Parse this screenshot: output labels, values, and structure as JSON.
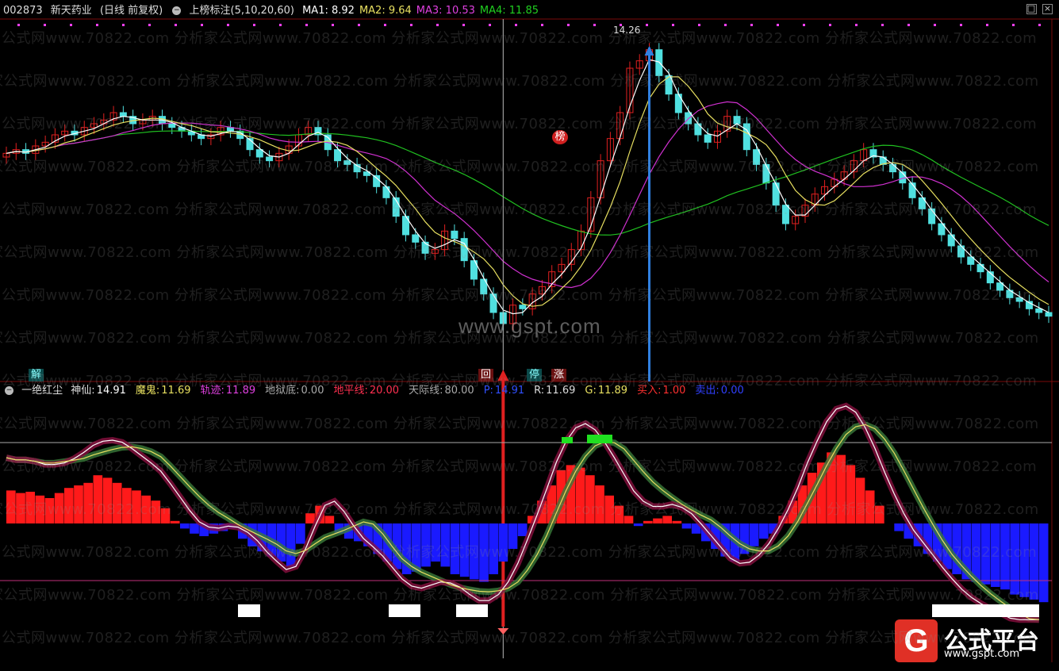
{
  "header_top": {
    "code": "002873",
    "name": "新天药业",
    "mode": "(日线 前复权)",
    "indicator": "上榜标注(5,10,20,60)",
    "ma": [
      {
        "label": "MA1:",
        "value": "8.92",
        "color": "#ffffff"
      },
      {
        "label": "MA2:",
        "value": "9.64",
        "color": "#e8e060"
      },
      {
        "label": "MA3:",
        "value": "10.53",
        "color": "#e040e0"
      },
      {
        "label": "MA4:",
        "value": "11.85",
        "color": "#20d020"
      }
    ]
  },
  "header_bottom": {
    "name": "一绝红尘",
    "items": [
      {
        "label": "神仙:",
        "value": "14.91",
        "lcolor": "#dddddd",
        "vcolor": "#ffffff"
      },
      {
        "label": "魔鬼:",
        "value": "11.69",
        "lcolor": "#e8e060",
        "vcolor": "#e8e060"
      },
      {
        "label": "轨迹:",
        "value": "11.89",
        "lcolor": "#e040e0",
        "vcolor": "#e040e0"
      },
      {
        "label": "地狱底:",
        "value": "0.00",
        "lcolor": "#aaaaaa",
        "vcolor": "#aaaaaa"
      },
      {
        "label": "地平线:",
        "value": "20.00",
        "lcolor": "#ff3050",
        "vcolor": "#ff3050"
      },
      {
        "label": "天际线:",
        "value": "80.00",
        "lcolor": "#aaaaaa",
        "vcolor": "#aaaaaa"
      },
      {
        "label": "P:",
        "value": "14.91",
        "lcolor": "#3050ff",
        "vcolor": "#3050ff"
      },
      {
        "label": "R:",
        "value": "11.69",
        "lcolor": "#dddddd",
        "vcolor": "#dddddd"
      },
      {
        "label": "G:",
        "value": "11.89",
        "lcolor": "#e8e060",
        "vcolor": "#e8e060"
      },
      {
        "label": "买入:",
        "value": "1.00",
        "lcolor": "#ff3030",
        "vcolor": "#ff3030"
      },
      {
        "label": "卖出:",
        "value": "0.00",
        "lcolor": "#3040ff",
        "vcolor": "#3040ff"
      }
    ]
  },
  "tags": {
    "jie": "解",
    "hui": "回",
    "ting": "停",
    "zhang": "涨",
    "bang": "榜"
  },
  "annotations": {
    "high_label": "14.26"
  },
  "watermark": {
    "text": "公式网www.70822.com 分析家公式网www.70822.com 分析家公式网www.70822.com 分析家公式网www.70822.com 分析家公式网www.70822.com",
    "text2": "家公式网www.70822.com 分析家公式网www.70822.com 分析家公式网www.70822.com 分析家公式网www.70822.com 分析家公式网www.70822.com",
    "site": "www.gspt.com"
  },
  "logo": {
    "mark": "G",
    "title": "公式平台",
    "url": "www.gspt.com"
  },
  "colors": {
    "up": "#e02020",
    "down": "#50e0e0",
    "ma1": "#ffffff",
    "ma2": "#e8e060",
    "ma3": "#d030d0",
    "ma4": "#20c020",
    "red_bar": "#ff1a1a",
    "blue_bar": "#1a1aff"
  },
  "chart_data": [
    {
      "type": "candlestick",
      "series": [
        {
          "name": "MA1",
          "last": 8.92
        },
        {
          "name": "MA2",
          "last": 9.64
        },
        {
          "name": "MA3",
          "last": 10.53
        },
        {
          "name": "MA4",
          "last": 11.85
        }
      ],
      "close": [
        11.5,
        11.6,
        11.5,
        11.7,
        11.8,
        12.0,
        12.1,
        12.0,
        12.2,
        12.3,
        12.4,
        12.6,
        12.5,
        12.3,
        12.4,
        12.5,
        12.3,
        12.2,
        12.1,
        12.0,
        11.9,
        12.0,
        12.2,
        12.1,
        11.9,
        11.6,
        11.4,
        11.3,
        11.5,
        11.7,
        12.0,
        12.2,
        12.0,
        11.6,
        11.3,
        11.2,
        11.0,
        10.9,
        10.6,
        10.3,
        9.8,
        9.3,
        9.1,
        8.8,
        8.9,
        9.4,
        9.2,
        8.6,
        8.1,
        7.7,
        7.2,
        6.9,
        7.4,
        7.3,
        7.7,
        7.9,
        8.3,
        8.5,
        8.9,
        9.4,
        10.3,
        11.3,
        11.9,
        12.6,
        13.8,
        14.0,
        14.3,
        13.6,
        13.1,
        12.6,
        12.3,
        12.0,
        11.8,
        12.1,
        12.5,
        12.3,
        11.6,
        11.2,
        10.7,
        10.1,
        9.6,
        9.8,
        10.1,
        10.4,
        10.6,
        10.8,
        11.0,
        11.3,
        11.6,
        11.4,
        11.2,
        11.0,
        10.7,
        10.3,
        10.0,
        9.6,
        9.3,
        9.0,
        8.7,
        8.5,
        8.3,
        8.0,
        7.8,
        7.6,
        7.5,
        7.3,
        7.2,
        7.1
      ],
      "high_label": 14.26
    },
    {
      "type": "indicator",
      "histogram": [
        26,
        24,
        25,
        22,
        20,
        24,
        28,
        30,
        32,
        38,
        36,
        32,
        28,
        26,
        22,
        18,
        12,
        2,
        -4,
        -8,
        -10,
        -8,
        -6,
        -4,
        -12,
        -18,
        -22,
        -26,
        -30,
        -34,
        -16,
        8,
        14,
        6,
        -8,
        -12,
        -14,
        -18,
        -24,
        -30,
        -36,
        -40,
        -38,
        -34,
        -30,
        -34,
        -40,
        -42,
        -44,
        -46,
        -40,
        -30,
        -20,
        -10,
        6,
        18,
        30,
        42,
        46,
        44,
        38,
        30,
        22,
        14,
        6,
        -2,
        2,
        4,
        6,
        2,
        -4,
        -8,
        -14,
        -20,
        -26,
        -30,
        -24,
        -18,
        -12,
        -8,
        6,
        18,
        30,
        40,
        48,
        56,
        54,
        46,
        36,
        26,
        14,
        0,
        -6,
        -12,
        -18,
        -24,
        -30,
        -36,
        -40,
        -44,
        -46,
        -48,
        -50,
        -52,
        -56,
        -58,
        -60,
        -62
      ],
      "levels": {
        "bottom": 0,
        "horizon": 20,
        "sky": 80
      }
    }
  ]
}
